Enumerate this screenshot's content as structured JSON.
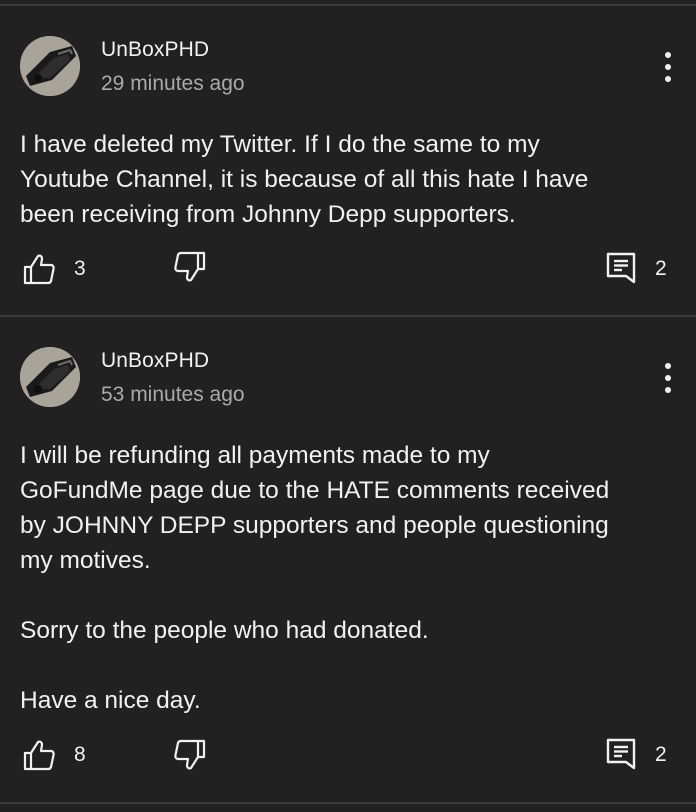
{
  "comments": [
    {
      "author": "UnBoxPHD",
      "time": "29 minutes ago",
      "text": "I have deleted my Twitter. If I do the same to my\nYoutube Channel, it is because of all this hate I have\nbeen receiving from Johnny Depp supporters.",
      "likes": "3",
      "replies": "2"
    },
    {
      "author": "UnBoxPHD",
      "time": "53 minutes ago",
      "text": "I will be refunding all payments made to my\nGoFundMe page due to the HATE comments received\nby JOHNNY DEPP supporters and people questioning\nmy motives.\n\nSorry to the people who had donated.\n\nHave a nice day.",
      "likes": "8",
      "replies": "2"
    }
  ],
  "icons": {
    "avatar": "user-avatar",
    "more": "more-vertical-icon",
    "like": "thumbs-up-icon",
    "dislike": "thumbs-down-icon",
    "reply": "reply-comment-icon"
  },
  "colors": {
    "background": "#212121",
    "divider": "#3a3a3a",
    "text": "#f1f1f1",
    "secondary_text": "#aaaaaa"
  }
}
